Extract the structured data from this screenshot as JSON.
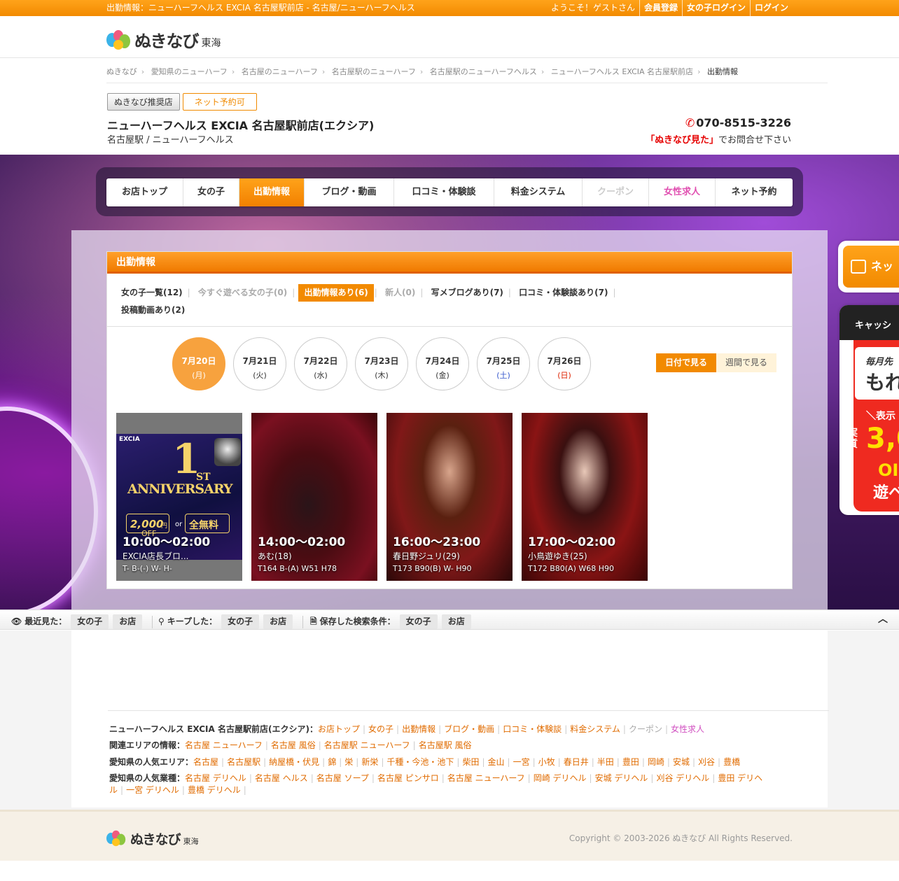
{
  "topbar": {
    "title": "出勤情報：ニューハーフヘルス EXCIA 名古屋駅前店 - 名古屋/ニューハーフヘルス",
    "welcome": "ようこそ！ゲストさん",
    "register": "会員登録",
    "girl_login": "女の子ログイン",
    "login": "ログイン"
  },
  "logo": {
    "text": "ぬきなび",
    "region": "東海"
  },
  "breadcrumb": [
    "ぬきなび",
    "愛知県のニューハーフ",
    "名古屋のニューハーフ",
    "名古屋駅のニューハーフ",
    "名古屋駅のニューハーフヘルス",
    "ニューハーフヘルス EXCIA 名古屋駅前店",
    "出勤情報"
  ],
  "shop": {
    "badge_recommend": "ぬきなび推奨店",
    "badge_reserve": "ネット予約可",
    "name": "ニューハーフヘルス EXCIA 名古屋駅前店(エクシア)",
    "sub": "名古屋駅 / ニューハーフヘルス",
    "phone": "070-8515-3226",
    "phone_note_highlight": "「ぬきなび見た」",
    "phone_note": "でお問合せ下さい"
  },
  "nav": [
    {
      "label": "お店トップ"
    },
    {
      "label": "女の子"
    },
    {
      "label": "出勤情報"
    },
    {
      "label": "ブログ・動画"
    },
    {
      "label": "口コミ・体験談"
    },
    {
      "label": "料金システム"
    },
    {
      "label": "クーポン"
    },
    {
      "label": "女性求人"
    },
    {
      "label": "ネット予約"
    }
  ],
  "panel": {
    "title": "出勤情報",
    "tabs": [
      {
        "label": "女の子一覧(12)"
      },
      {
        "label": "今すぐ遊べる女の子(0)"
      },
      {
        "label": "出勤情報あり(6)"
      },
      {
        "label": "新人(0)"
      },
      {
        "label": "写メブログあり(7)"
      },
      {
        "label": "口コミ・体験談あり(7)"
      },
      {
        "label": "投稿動画あり(2)"
      }
    ],
    "days": [
      {
        "date": "7月20日",
        "week": "(月)"
      },
      {
        "date": "7月21日",
        "week": "(火)"
      },
      {
        "date": "7月22日",
        "week": "(水)"
      },
      {
        "date": "7月23日",
        "week": "(木)"
      },
      {
        "date": "7月24日",
        "week": "(金)"
      },
      {
        "date": "7月25日",
        "week": "(土)"
      },
      {
        "date": "7月26日",
        "week": "(日)"
      }
    ],
    "view_day": "日付で見る",
    "view_week": "週間で見る",
    "cards": [
      {
        "time": "10:00〜02:00",
        "name": "EXCIA店長ブロ...",
        "size": "T- B-(-) W- H-",
        "banner_brand": "EXCIA",
        "banner_big": "1",
        "banner_st": "ST",
        "banner_word": "ANNIVERSARY",
        "banner_price": "2,000",
        "banner_yen": "円",
        "banner_or": "or",
        "banner_free": "全無料",
        "banner_off": "OFF"
      },
      {
        "time": "14:00〜02:00",
        "name": "あむ(18)",
        "size": "T164 B-(A) W51 H78"
      },
      {
        "time": "16:00〜23:00",
        "name": "春日野ジュリ(29)",
        "size": "T173 B90(B) W- H90"
      },
      {
        "time": "17:00〜02:00",
        "name": "小鳥遊ゆき(25)",
        "size": "T172 B80(A) W68 H90"
      }
    ]
  },
  "side": {
    "reserve": "ネッ",
    "cashback_head": "キャッシ",
    "promo1": "毎月先",
    "promo1_big": "もれ",
    "promo2": "＼表示",
    "promo3": "実質",
    "promo4": "3,0",
    "promo5": "OI",
    "promo6": "遊ベ"
  },
  "history": {
    "recent": "最近見た：",
    "kept": "キープした：",
    "saved": "保存した検索条件：",
    "girl": "女の子",
    "shop": "お店"
  },
  "footer": {
    "row1_label": "ニューハーフヘルス EXCIA 名古屋駅前店(エクシア)：",
    "row1": [
      "お店トップ",
      "女の子",
      "出勤情報",
      "ブログ・動画",
      "口コミ・体験談",
      "料金システム",
      "クーポン",
      "女性求人"
    ],
    "row2_label": "関連エリアの情報：",
    "row2": [
      "名古屋 ニューハーフ",
      "名古屋 風俗",
      "名古屋駅 ニューハーフ",
      "名古屋駅 風俗"
    ],
    "row3_label": "愛知県の人気エリア：",
    "row3": [
      "名古屋",
      "名古屋駅",
      "納屋橋・伏見",
      "錦",
      "栄",
      "新栄",
      "千種・今池・池下",
      "柴田",
      "金山",
      "一宮",
      "小牧",
      "春日井",
      "半田",
      "豊田",
      "岡崎",
      "安城",
      "刈谷",
      "豊橋"
    ],
    "row4_label": "愛知県の人気業種：",
    "row4": [
      "名古屋 デリヘル",
      "名古屋 ヘルス",
      "名古屋 ソープ",
      "名古屋 ピンサロ",
      "名古屋 ニューハーフ",
      "岡崎 デリヘル",
      "安城 デリヘル",
      "刈谷 デリヘル",
      "豊田 デリヘル",
      "一宮 デリヘル",
      "豊橋 デリヘル"
    ],
    "copyright": "Copyright © 2003-2026 ぬきなび All Rights Reserved."
  },
  "colors": {
    "accent": "#f28a00",
    "pink": "#d04fc0",
    "red": "#e60000"
  }
}
